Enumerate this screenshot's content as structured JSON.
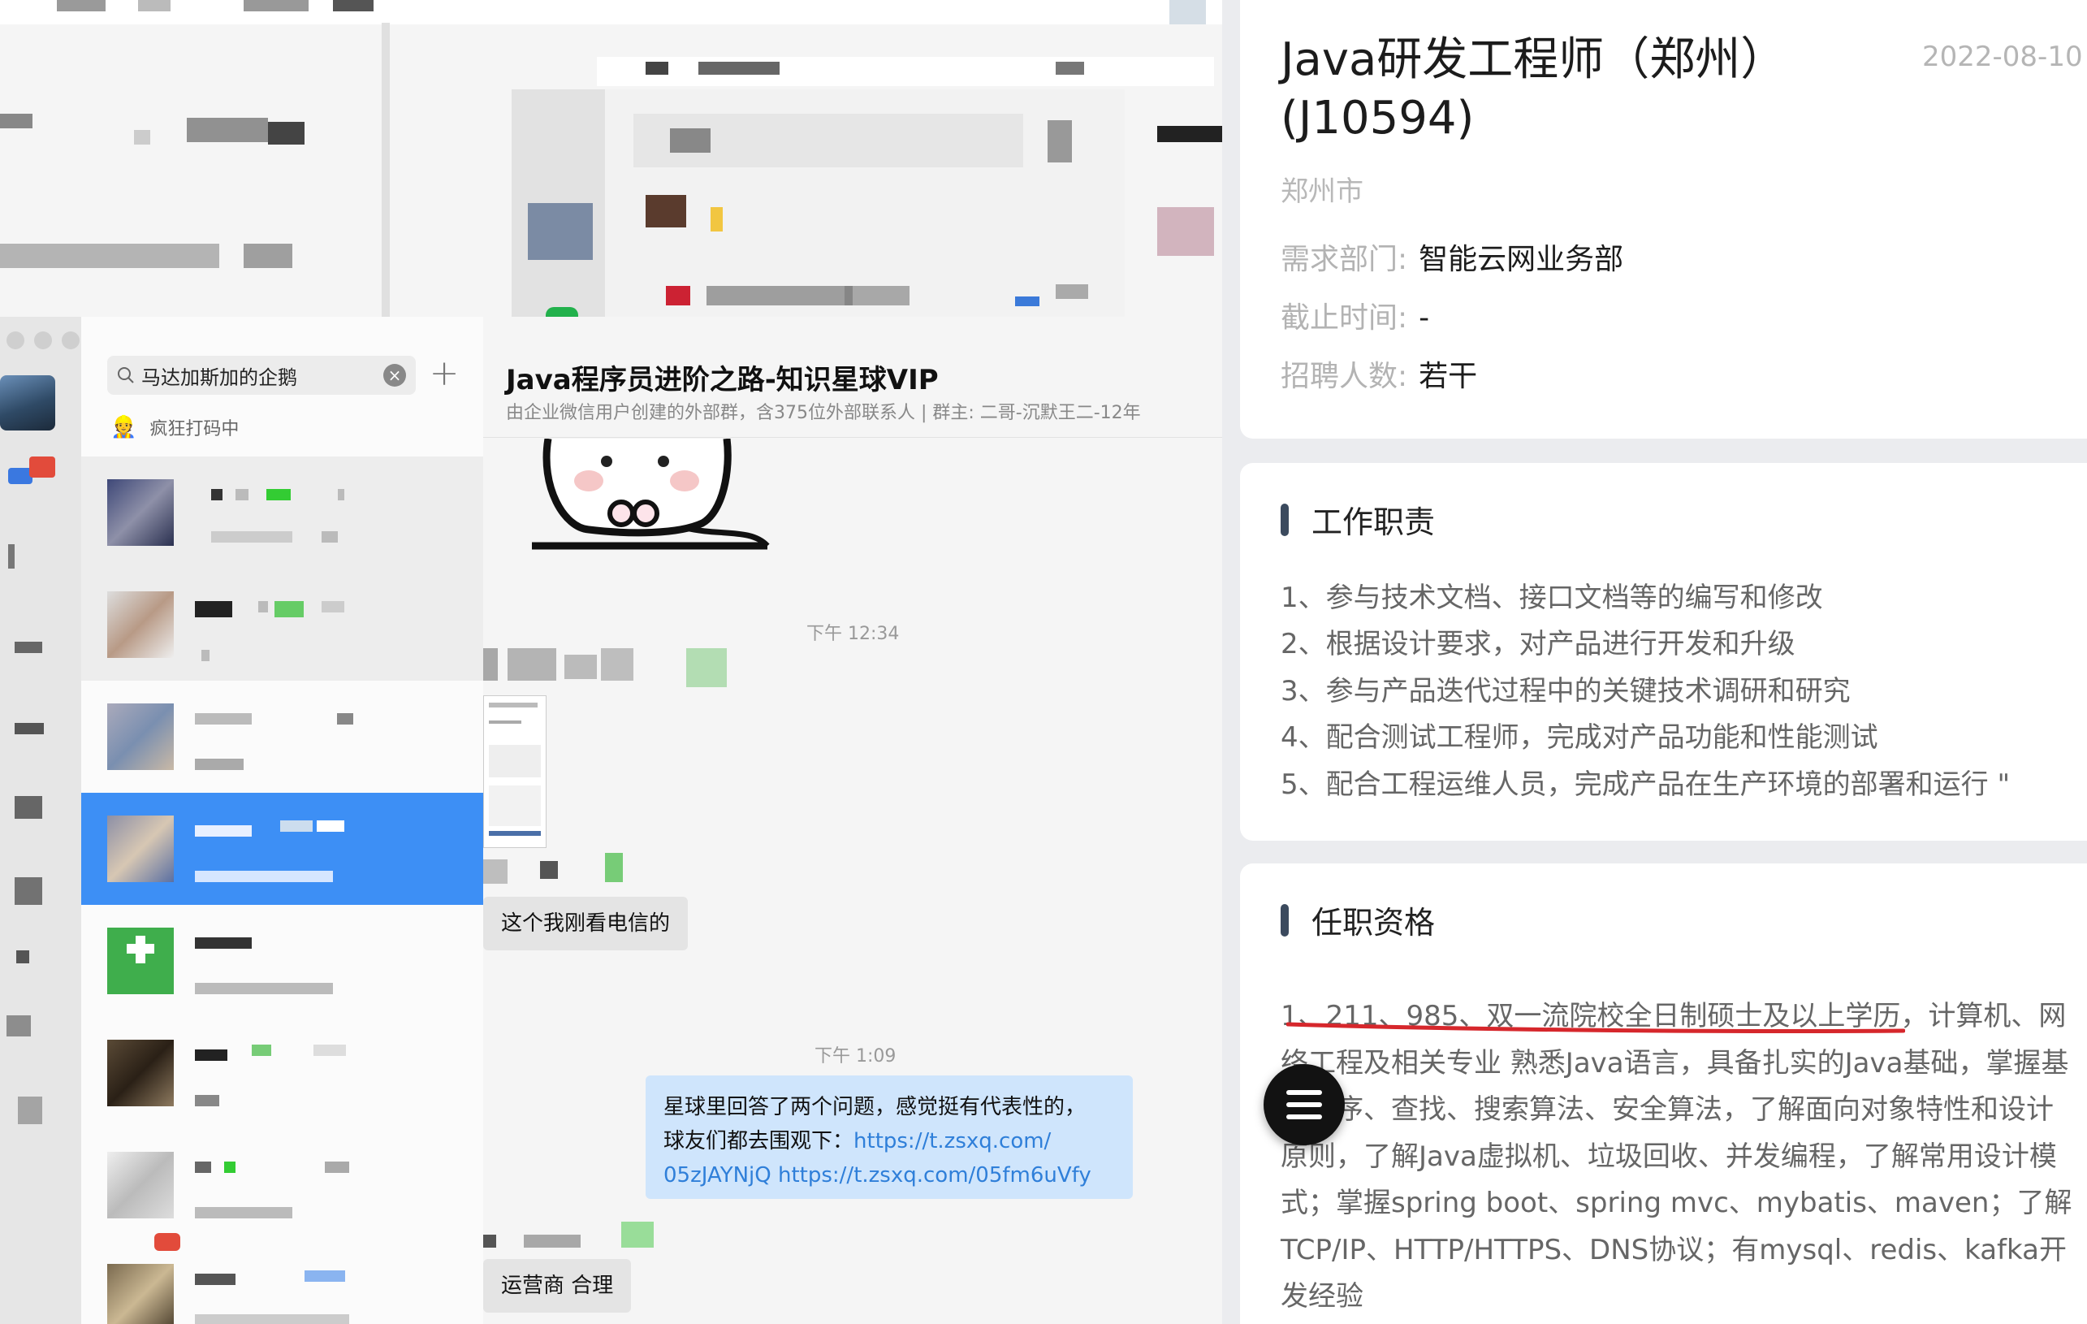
{
  "chat": {
    "search_text": "马达加斯加的企鹅",
    "status_emoji": "👷",
    "status_text": "疯狂打码中",
    "header": {
      "title": "Java程序员进阶之路-知识星球VIP",
      "subtitle": "由企业微信用户创建的外部群，含375位外部联系人 | 群主: 二哥-沉默王二-12年"
    },
    "messages": [
      {
        "type": "time",
        "text": "下午 12:34"
      },
      {
        "type": "text",
        "text": "这个我刚看电信的"
      },
      {
        "type": "time",
        "text": "下午 1:09"
      },
      {
        "type": "text_out",
        "line1": "星球里回答了两个问题，感觉挺有代表性的，",
        "line2_prefix": "球友们都去围观下：",
        "link1_a": "https://t.zsxq.com/",
        "link1_b": "05zJAYNjQ",
        "link2": "https://t.zsxq.com/05fm6uVfy"
      },
      {
        "type": "text",
        "text": "运营商 合理"
      }
    ]
  },
  "job": {
    "title": "Java研发工程师（郑州）(J10594)",
    "date": "2022-08-10",
    "city": "郑州市",
    "fields": [
      {
        "label": "需求部门:",
        "value": "智能云网业务部"
      },
      {
        "label": "截止时间:",
        "value": "-"
      },
      {
        "label": "招聘人数:",
        "value": "若干"
      }
    ],
    "responsibilities": {
      "title": "工作职责",
      "items": [
        "1、参与技术文档、接口文档等的编写和修改",
        "2、根据设计要求，对产品进行开发和升级",
        "3、参与产品迭代过程中的关键技术调研和研究",
        "4、配合测试工程师，完成对产品功能和性能测试",
        "5、配合工程运维人员，完成产品在生产环境的部署和运行 \""
      ]
    },
    "qualifications": {
      "title": "任职资格",
      "text": "1、211、985、双一流院校全日制硕士及以上学历，计算机、网络工程及相关专业 熟悉Java语言，具备扎实的Java基础，掌握基本排序、查找、搜索算法、安全算法，了解面向对象特性和设计原则，了解Java虚拟机、垃圾回收、并发编程，了解常用设计模式；掌握spring boot、spring mvc、mybatis、maven；了解TCP/IP、HTTP/HTTPS、DNS协议；有mysql、redis、kafka开发经验"
    }
  },
  "colors": {
    "accent_blue": "#3d8ff5",
    "bubble_out": "#cfe5fc",
    "link": "#2f7fd9",
    "underline_red": "#d6272c",
    "fab": "#121212"
  },
  "icons": [
    "search-icon",
    "clear-icon",
    "plus-icon",
    "menu-icon"
  ]
}
